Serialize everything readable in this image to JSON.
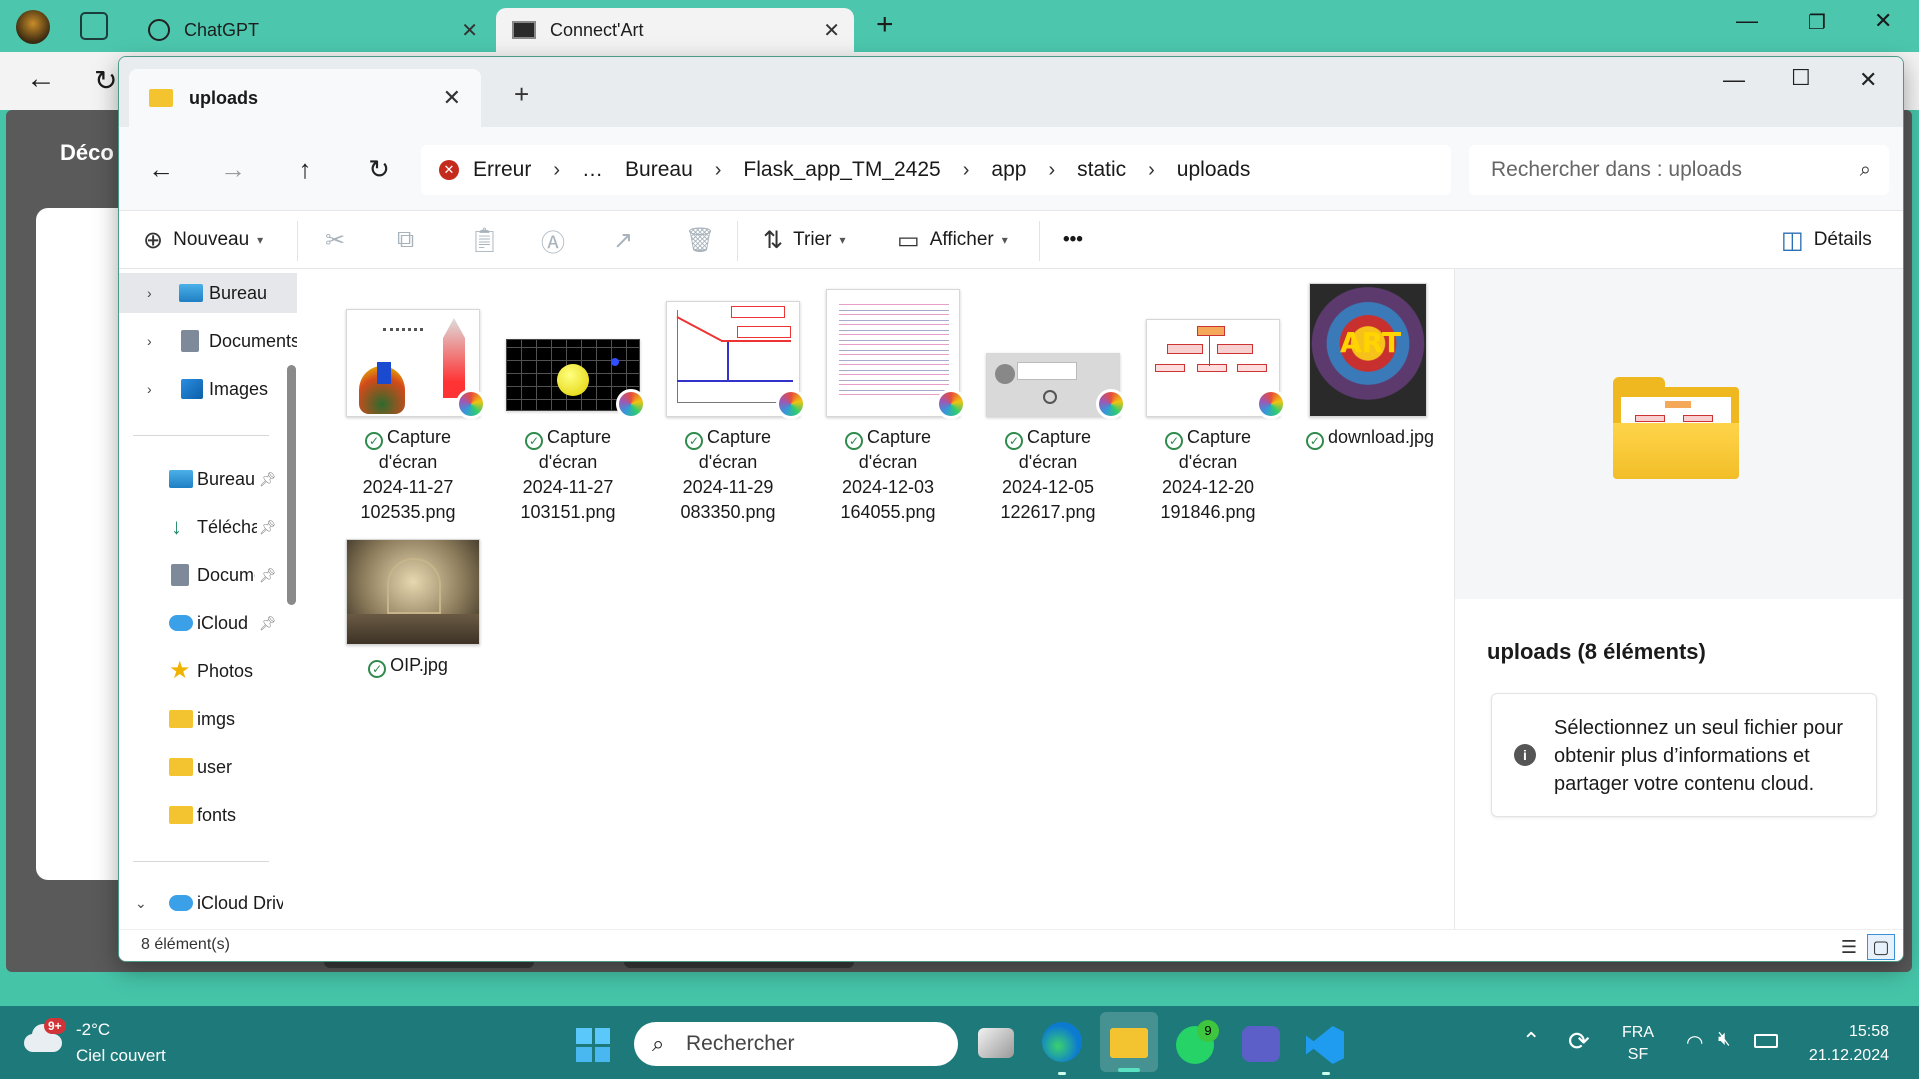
{
  "browser": {
    "tabs": [
      {
        "label": "ChatGPT"
      },
      {
        "label": "Connect'Art"
      }
    ],
    "page_heading_partial": "Déco"
  },
  "window": {
    "tab_title": "uploads",
    "breadcrumb": [
      "Erreur",
      "…",
      "Bureau",
      "Flask_app_TM_2425",
      "app",
      "static",
      "uploads"
    ],
    "search_placeholder": "Rechercher dans : uploads"
  },
  "commandbar": {
    "new_label": "Nouveau",
    "sort_label": "Trier",
    "view_label": "Afficher",
    "more_label": "•••",
    "details_label": "Détails"
  },
  "sidebar": {
    "items": [
      {
        "label": "Bureau",
        "icon": "desktop-icon",
        "expandable": true,
        "selected": true
      },
      {
        "label": "Documents",
        "icon": "documents-icon",
        "expandable": true
      },
      {
        "label": "Images",
        "icon": "images-icon",
        "expandable": true
      },
      {
        "label": "Bureau",
        "icon": "desktop-icon",
        "pinned": true
      },
      {
        "label": "Téléchargements",
        "icon": "download-icon",
        "pinned": true
      },
      {
        "label": "Documents",
        "icon": "documents-icon",
        "pinned": true
      },
      {
        "label": "iCloud",
        "icon": "icloud-icon",
        "pinned": true
      },
      {
        "label": "Photos",
        "icon": "star-icon"
      },
      {
        "label": "imgs",
        "icon": "folder-icon"
      },
      {
        "label": "user",
        "icon": "folder-icon"
      },
      {
        "label": "fonts",
        "icon": "folder-icon"
      },
      {
        "label": "iCloud Drive",
        "icon": "icloud-icon",
        "expanded": true
      }
    ]
  },
  "files": [
    {
      "line1": "Capture",
      "line2": "d'écran",
      "line3": "2024-11-27",
      "line4": "102535.png"
    },
    {
      "line1": "Capture",
      "line2": "d'écran",
      "line3": "2024-11-27",
      "line4": "103151.png"
    },
    {
      "line1": "Capture",
      "line2": "d'écran",
      "line3": "2024-11-29",
      "line4": "083350.png"
    },
    {
      "line1": "Capture",
      "line2": "d'écran",
      "line3": "2024-12-03",
      "line4": "164055.png"
    },
    {
      "line1": "Capture",
      "line2": "d'écran",
      "line3": "2024-12-05",
      "line4": "122617.png"
    },
    {
      "line1": "Capture",
      "line2": "d'écran",
      "line3": "2024-12-20",
      "line4": "191846.png"
    },
    {
      "line1": "download.jpg"
    },
    {
      "line1": "OIP.jpg"
    }
  ],
  "details": {
    "title": "uploads (8 éléments)",
    "info": "Sélectionnez un seul fichier pour obtenir plus d’informations et partager votre contenu cloud."
  },
  "status": {
    "count": "8 élément(s)"
  },
  "taskbar": {
    "weather_badge": "9+",
    "temperature": "-2°C",
    "condition": "Ciel couvert",
    "search_placeholder": "Rechercher",
    "whatsapp_badge": "9",
    "lang1": "FRA",
    "lang2": "SF",
    "time": "15:58",
    "date": "21.12.2024"
  }
}
